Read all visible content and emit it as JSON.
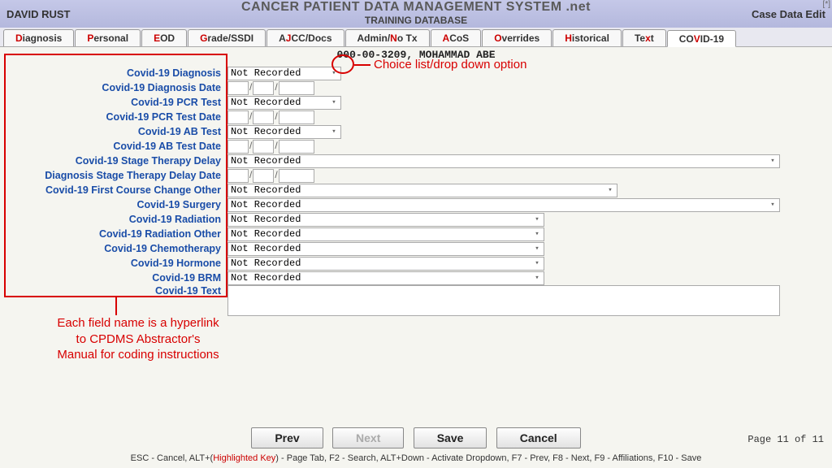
{
  "header": {
    "user": "DAVID RUST",
    "title": "CANCER PATIENT DATA MANAGEMENT SYSTEM .net",
    "subtitle": "TRAINING DATABASE",
    "right": "Case Data Edit",
    "corner": "[*]"
  },
  "tabs": [
    {
      "hl": "D",
      "rest": "iagnosis"
    },
    {
      "hl": "P",
      "rest": "ersonal"
    },
    {
      "hl": "E",
      "rest": "OD"
    },
    {
      "hl": "G",
      "rest": "rade/SSDI"
    },
    {
      "hl": "J",
      "pre": "A",
      "rest": "CC/Docs"
    },
    {
      "hl": "N",
      "pre": "Admin/",
      "rest": "o Tx"
    },
    {
      "hl": "A",
      "rest": "CoS"
    },
    {
      "hl": "O",
      "rest": "verrides"
    },
    {
      "hl": "H",
      "rest": "istorical"
    },
    {
      "hl": "x",
      "pre": "Te",
      "rest": "t"
    },
    {
      "hl": "V",
      "pre": "CO",
      "rest": "ID-19"
    }
  ],
  "patient": "000-00-3209, MOHAMMAD ABE",
  "defaults": {
    "not_recorded": "Not Recorded"
  },
  "fields": {
    "diagnosis": "Covid-19 Diagnosis",
    "diagnosis_date": "Covid-19 Diagnosis Date",
    "pcr_test": "Covid-19 PCR Test",
    "pcr_date": "Covid-19 PCR Test Date",
    "ab_test": "Covid-19 AB Test",
    "ab_date": "Covid-19 AB Test Date",
    "stage_delay": "Covid-19 Stage Therapy Delay",
    "stage_delay_date": "Diagnosis Stage Therapy Delay Date",
    "first_course": "Covid-19 First Course Change Other",
    "surgery": "Covid-19 Surgery",
    "radiation": "Covid-19 Radiation",
    "radiation_other": "Covid-19 Radiation Other",
    "chemo": "Covid-19 Chemotherapy",
    "hormone": "Covid-19 Hormone",
    "brm": "Covid-19 BRM",
    "text": "Covid-19 Text"
  },
  "annotations": {
    "dropdown": "Choice list/drop down option",
    "labels": "Each field name is a hyperlink to CPDMS Abstractor's Manual for coding instructions"
  },
  "footer": {
    "prev": "Prev",
    "next": "Next",
    "save": "Save",
    "cancel": "Cancel",
    "page": "Page 11 of 11",
    "hint_pre": "ESC - Cancel, ALT+(",
    "hint_hl": "Highlighted Key",
    "hint_post": ") - Page Tab, F2 - Search, ALT+Down - Activate Dropdown, F7 - Prev, F8 - Next, F9 - Affiliations, F10 - Save"
  }
}
